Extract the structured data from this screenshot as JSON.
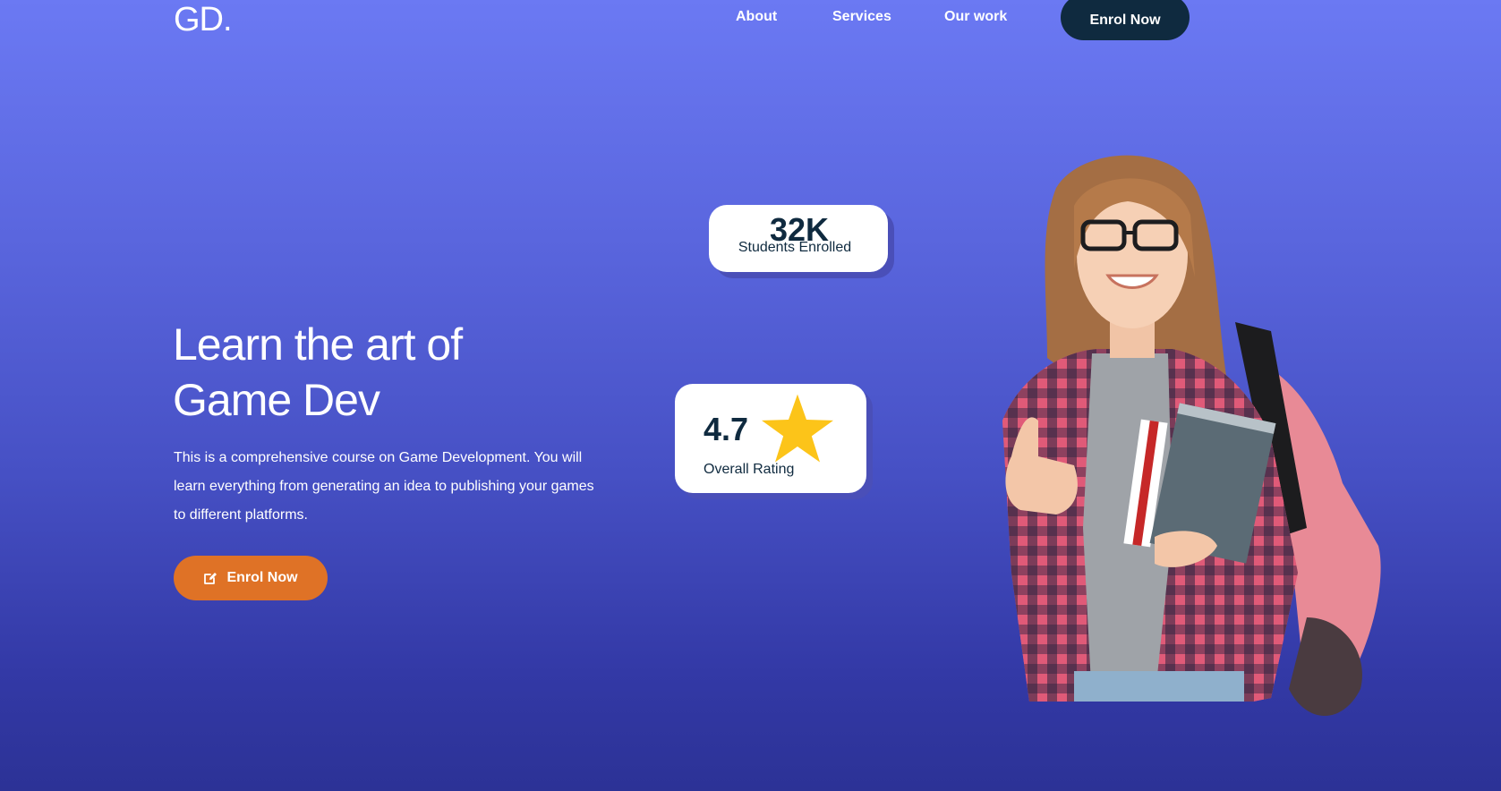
{
  "nav": {
    "logo": "GD.",
    "links": [
      "About",
      "Services",
      "Our work"
    ],
    "enrol_label": "Enrol Now"
  },
  "hero": {
    "title_line1": "Learn the art of",
    "title_line2": "Game Dev",
    "description": "This is a comprehensive course on Game Development. You will learn everything from generating an idea to publishing your games to different platforms.",
    "cta_label": "Enrol Now",
    "cta_icon": "edit-icon"
  },
  "stats": {
    "students_value": "32K",
    "students_label": "Students Enrolled",
    "rating_value": "4.7",
    "rating_label": "Overall Rating",
    "rating_icon": "star-icon"
  },
  "colors": {
    "gradient_top": "#6b79f3",
    "gradient_bottom": "#2c3296",
    "dark_navy": "#0f2a3f",
    "orange": "#df7226",
    "star": "#fcc419"
  }
}
